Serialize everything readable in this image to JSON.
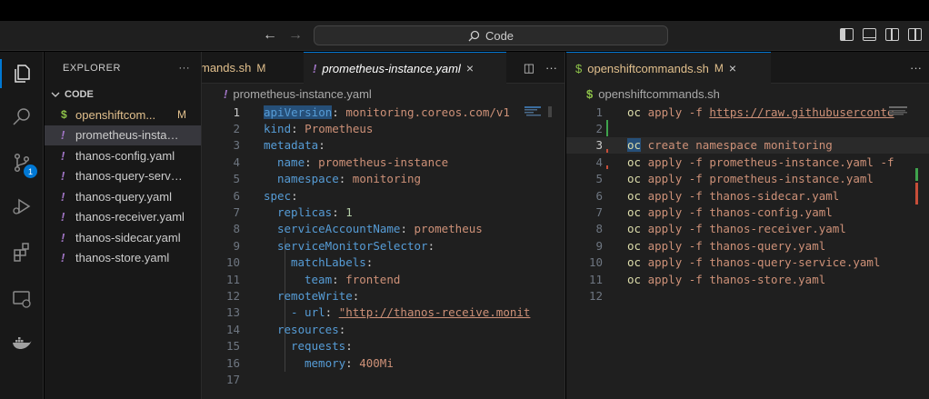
{
  "titlebar": {
    "back_arrow": "←",
    "forward_arrow": "→",
    "command_center": "Code"
  },
  "activity_bar": {
    "source_control_badge": "1"
  },
  "sidebar": {
    "header": "EXPLORER",
    "more": "···",
    "section": "CODE",
    "files": [
      {
        "icon": "$",
        "name": "openshiftcom...",
        "status": "M"
      },
      {
        "icon": "!",
        "name": "prometheus-instanc...",
        "status": ""
      },
      {
        "icon": "!",
        "name": "thanos-config.yaml",
        "status": ""
      },
      {
        "icon": "!",
        "name": "thanos-query-servic...",
        "status": ""
      },
      {
        "icon": "!",
        "name": "thanos-query.yaml",
        "status": ""
      },
      {
        "icon": "!",
        "name": "thanos-receiver.yaml",
        "status": ""
      },
      {
        "icon": "!",
        "name": "thanos-sidecar.yaml",
        "status": ""
      },
      {
        "icon": "!",
        "name": "thanos-store.yaml",
        "status": ""
      }
    ]
  },
  "editor1": {
    "tabs": [
      {
        "label": "mands.sh",
        "status": "M"
      },
      {
        "icon": "!",
        "label": "prometheus-instance.yaml",
        "close": "×"
      }
    ],
    "actions": {
      "split": "◫",
      "more": "···"
    },
    "breadcrumb": {
      "icon": "!",
      "label": "prometheus-instance.yaml"
    },
    "line_numbers": [
      "1",
      "2",
      "3",
      "4",
      "5",
      "6",
      "7",
      "8",
      "9",
      "10",
      "11",
      "12",
      "13",
      "14",
      "15",
      "16",
      "17"
    ],
    "lines": [
      {
        "key": "apiVersion",
        "sep": ": ",
        "val": "monitoring.coreos.com/v1"
      },
      {
        "key": "kind",
        "sep": ": ",
        "val": "Prometheus"
      },
      {
        "key": "metadata",
        "sep": ":",
        "val": ""
      },
      {
        "key": "name",
        "sep": ": ",
        "val": "prometheus-instance"
      },
      {
        "key": "namespace",
        "sep": ": ",
        "val": "monitoring"
      },
      {
        "key": "spec",
        "sep": ":",
        "val": ""
      },
      {
        "key": "replicas",
        "sep": ": ",
        "val": "1"
      },
      {
        "key": "serviceAccountName",
        "sep": ": ",
        "val": "prometheus"
      },
      {
        "key": "serviceMonitorSelector",
        "sep": ":",
        "val": ""
      },
      {
        "key": "matchLabels",
        "sep": ":",
        "val": ""
      },
      {
        "key": "team",
        "sep": ": ",
        "val": "frontend"
      },
      {
        "key": "remoteWrite",
        "sep": ":",
        "val": ""
      },
      {
        "key": "- url",
        "sep": ": ",
        "val": "\"http://thanos-receive.monit"
      },
      {
        "key": "resources",
        "sep": ":",
        "val": ""
      },
      {
        "key": "requests",
        "sep": ":",
        "val": ""
      },
      {
        "key": "memory",
        "sep": ": ",
        "val": "400Mi"
      },
      {
        "key": "",
        "sep": "",
        "val": ""
      }
    ]
  },
  "editor2": {
    "tab": {
      "icon": "$",
      "label": "openshiftcommands.sh",
      "status": "M",
      "close": "×"
    },
    "more": "···",
    "breadcrumb": {
      "icon": "$",
      "label": "openshiftcommands.sh"
    },
    "line_numbers": [
      "1",
      "2",
      "3",
      "4",
      "5",
      "6",
      "7",
      "8",
      "9",
      "10",
      "11",
      "12"
    ],
    "lines": [
      {
        "cmd": "oc",
        "rest": " apply -f ",
        "arg": "https://raw.githubuserconte"
      },
      {
        "cmd": "",
        "rest": "",
        "arg": ""
      },
      {
        "cmd": "oc",
        "rest": " create namespace monitoring",
        "arg": ""
      },
      {
        "cmd": "oc",
        "rest": " apply -f prometheus-instance.yaml -f",
        "arg": ""
      },
      {
        "cmd": "oc",
        "rest": " apply -f prometheus-instance.yaml",
        "arg": ""
      },
      {
        "cmd": "oc",
        "rest": " apply -f thanos-sidecar.yaml",
        "arg": ""
      },
      {
        "cmd": "oc",
        "rest": " apply -f thanos-config.yaml",
        "arg": ""
      },
      {
        "cmd": "oc",
        "rest": " apply -f thanos-receiver.yaml",
        "arg": ""
      },
      {
        "cmd": "oc",
        "rest": " apply -f thanos-query.yaml",
        "arg": ""
      },
      {
        "cmd": "oc",
        "rest": " apply -f thanos-query-service.yaml",
        "arg": ""
      },
      {
        "cmd": "oc",
        "rest": " apply -f thanos-store.yaml",
        "arg": ""
      },
      {
        "cmd": "",
        "rest": "",
        "arg": ""
      }
    ]
  }
}
